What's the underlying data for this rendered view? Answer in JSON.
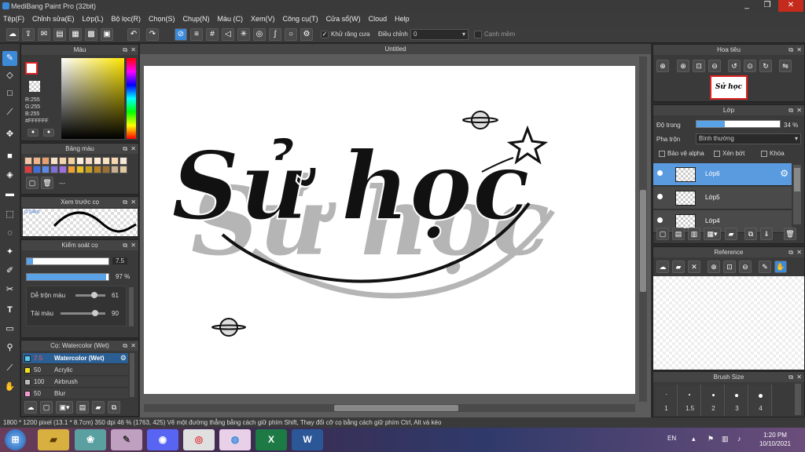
{
  "window": {
    "title": "MediBang Paint Pro (32bit)",
    "minimize": "_",
    "maximize": "❐",
    "close": "✕"
  },
  "menu": [
    "Tệp(F)",
    "Chỉnh sửa(E)",
    "Lớp(L)",
    "Bộ lọc(R)",
    "Chọn(S)",
    "Chụp(N)",
    "Màu (C)",
    "Xem(V)",
    "Công cụ(T)",
    "Cửa sổ(W)",
    "Cloud",
    "Help"
  ],
  "toolbar": {
    "antialias_label": "Khử răng cưa",
    "adjust_label": "Điều chỉnh",
    "adjust_value": "0",
    "edge_label": "Cạnh mềm"
  },
  "color_panel": {
    "title": "Màu",
    "r": "R:255",
    "g": "G:255",
    "b": "B:255",
    "hex": "#FFFFFF"
  },
  "palette_panel": {
    "title": "Bảng màu",
    "name": "---",
    "colors": [
      "#f4c7a4",
      "#f0b48a",
      "#e8a070",
      "#f8e0c8",
      "#f5d5b0",
      "#f3d0a0",
      "#fbeedc",
      "#f6ddc8",
      "#fde9d4",
      "#f9e2c0",
      "#f7d8b0",
      "#f4e8d8",
      "#e33b3b",
      "#3f6fdf",
      "#5c8aec",
      "#7f6fd8",
      "#a06ee0",
      "#f0a030",
      "#e8c020",
      "#c8a020",
      "#b88020",
      "#9c7030",
      "#c8b090",
      "#e0c8a0"
    ]
  },
  "brush_preview": {
    "title": "Xem trước cọ",
    "size": "0.54m"
  },
  "brush_control": {
    "title": "Kiểm soát cọ",
    "size_value": "7.5",
    "opacity_value": "97 %",
    "opacity_fraction": 0.97,
    "size_fraction": 0.08,
    "mix_label": "Dễ trộn màu",
    "mix_value": "61",
    "amount_label": "Tải màu",
    "amount_value": "90"
  },
  "brush_list": {
    "title": "Cọ: Watercolor (Wet)",
    "items": [
      {
        "size": "7.5",
        "name": "Watercolor (Wet)",
        "color": "#5ac8f0",
        "selected": true
      },
      {
        "size": "50",
        "name": "Acrylic",
        "color": "#f0e020",
        "selected": false
      },
      {
        "size": "100",
        "name": "Airbrush",
        "color": "#bbbbbb",
        "selected": false
      },
      {
        "size": "50",
        "name": "Blur",
        "color": "#f09ad0",
        "selected": false
      }
    ]
  },
  "document": {
    "tab": "Untitled"
  },
  "navigator": {
    "title": "Hoa tiêu",
    "thumb_text": "Sử học"
  },
  "layer_panel": {
    "title": "Lớp",
    "opacity_label": "Độ trong",
    "opacity_value": "34 %",
    "opacity_fraction": 0.34,
    "blend_label": "Pha trộn",
    "blend_value": "Bình thường",
    "protect_alpha": "Bảo vệ alpha",
    "clipping": "Xén bớt",
    "lock": "Khóa",
    "layers": [
      {
        "name": "Lớp6",
        "selected": true
      },
      {
        "name": "Lớp5",
        "selected": false
      },
      {
        "name": "Lớp4",
        "selected": false
      }
    ]
  },
  "reference_panel": {
    "title": "Reference"
  },
  "brush_size_panel": {
    "title": "Brush Size",
    "sizes": [
      "1",
      "1.5",
      "2",
      "3",
      "4"
    ]
  },
  "artwork": {
    "main_text": "Sử học"
  },
  "status": {
    "text": "1800 * 1200 pixel   (13.1 * 8.7cm)   350 dpi   46 %   (1763, 425)   Vẽ một đường thẳng bằng cách giữ phím Shift, Thay đổi cỡ cọ bằng cách giữ phím Ctrl, Alt và kéo"
  },
  "taskbar": {
    "lang": "EN",
    "time": "1:20 PM",
    "date": "10/10/2021"
  }
}
